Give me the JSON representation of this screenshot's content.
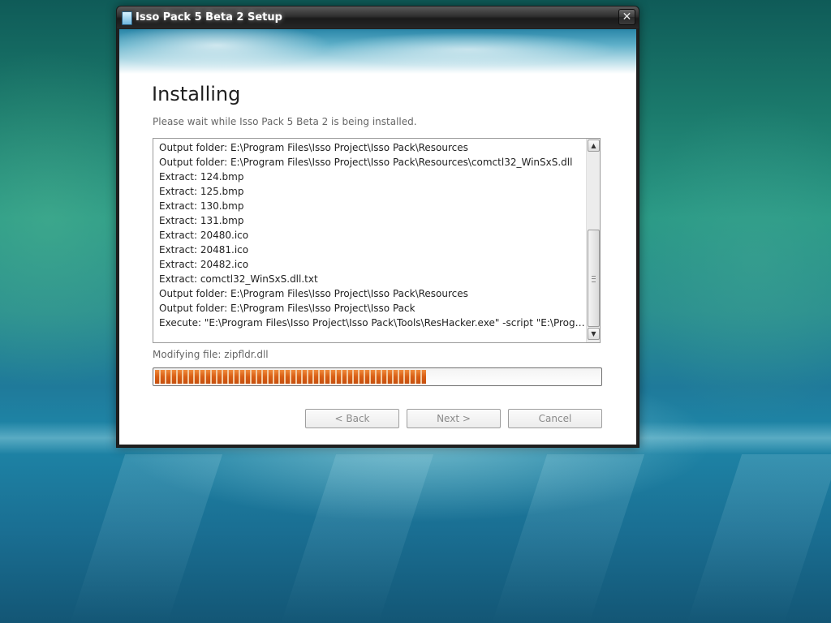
{
  "window": {
    "title": "Isso Pack 5 Beta 2 Setup",
    "close_glyph": "✕"
  },
  "page": {
    "heading": "Installing",
    "subheading": "Please wait while Isso Pack 5 Beta 2 is being installed."
  },
  "log": {
    "lines": [
      "Output folder: E:\\Program Files\\Isso Project\\Isso Pack\\Resources",
      "Output folder: E:\\Program Files\\Isso Project\\Isso Pack\\Resources\\comctl32_WinSxS.dll",
      "Extract: 124.bmp",
      "Extract: 125.bmp",
      "Extract: 130.bmp",
      "Extract: 131.bmp",
      "Extract: 20480.ico",
      "Extract: 20481.ico",
      "Extract: 20482.ico",
      "Extract: comctl32_WinSxS.dll.txt",
      "Output folder: E:\\Program Files\\Isso Project\\Isso Pack\\Resources",
      "Output folder: E:\\Program Files\\Isso Project\\Isso Pack",
      "Execute: \"E:\\Program Files\\Isso Project\\Isso Pack\\Tools\\ResHacker.exe\" -script \"E:\\Progr..."
    ],
    "scroll_up_glyph": "▲",
    "scroll_down_glyph": "▼"
  },
  "status": {
    "text": "Modifying file: zipfldr.dll",
    "progress_fraction": 0.61
  },
  "buttons": {
    "back": "< Back",
    "next": "Next >",
    "cancel": "Cancel"
  }
}
